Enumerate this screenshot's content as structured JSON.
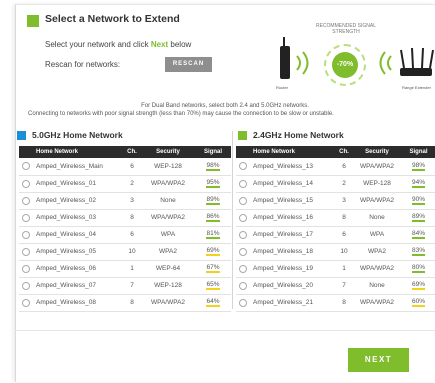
{
  "header": {
    "title": "Select a Network to Extend",
    "select_prefix": "Select your network and click ",
    "select_highlight": "Next",
    "select_suffix": " below",
    "rescan_prompt": "Rescan for networks:",
    "rescan_label": "RESCAN"
  },
  "diagram": {
    "recommended_label": "RECOMMENDED SIGNAL STRENGTH",
    "percent": "-70%",
    "router_label": "Router",
    "extender_label": "Range Extender"
  },
  "info": {
    "line1": "For Dual Band networks, select both 2.4 and 5.0GHz networks.",
    "line2": "Connecting to networks with poor signal strength (less than 70%) may cause the connection to be slow or unstable."
  },
  "colors": {
    "accent_green": "#7fbd2d",
    "five_ghz_blue": "#1a8fd6",
    "signal_green": "#7fbd2d",
    "signal_yellow": "#f2d21b"
  },
  "columns": {
    "network": "Home Network",
    "channel": "Ch.",
    "security": "Security",
    "signal": "Signal"
  },
  "band5": {
    "title": "5.0GHz Home Network",
    "rows": [
      {
        "name": "Amped_Wireless_Main",
        "ch": "6",
        "sec": "WEP-128",
        "sig": "98%",
        "level": "good"
      },
      {
        "name": "Amped_Wireless_01",
        "ch": "2",
        "sec": "WPA/WPA2",
        "sig": "95%",
        "level": "good"
      },
      {
        "name": "Amped_Wireless_02",
        "ch": "3",
        "sec": "None",
        "sig": "89%",
        "level": "good"
      },
      {
        "name": "Amped_Wireless_03",
        "ch": "8",
        "sec": "WPA/WPA2",
        "sig": "86%",
        "level": "good"
      },
      {
        "name": "Amped_Wireless_04",
        "ch": "6",
        "sec": "WPA",
        "sig": "81%",
        "level": "good"
      },
      {
        "name": "Amped_Wireless_05",
        "ch": "10",
        "sec": "WPA2",
        "sig": "69%",
        "level": "poor"
      },
      {
        "name": "Amped_Wireless_06",
        "ch": "1",
        "sec": "WEP-64",
        "sig": "67%",
        "level": "poor"
      },
      {
        "name": "Amped_Wireless_07",
        "ch": "7",
        "sec": "WEP-128",
        "sig": "65%",
        "level": "poor"
      },
      {
        "name": "Amped_Wireless_08",
        "ch": "8",
        "sec": "WPA/WPA2",
        "sig": "64%",
        "level": "poor"
      }
    ]
  },
  "band24": {
    "title": "2.4GHz Home Network",
    "rows": [
      {
        "name": "Amped_Wireless_13",
        "ch": "6",
        "sec": "WPA/WPA2",
        "sig": "98%",
        "level": "good"
      },
      {
        "name": "Amped_Wireless_14",
        "ch": "2",
        "sec": "WEP-128",
        "sig": "94%",
        "level": "good"
      },
      {
        "name": "Amped_Wireless_15",
        "ch": "3",
        "sec": "WPA/WPA2",
        "sig": "90%",
        "level": "good"
      },
      {
        "name": "Amped_Wireless_16",
        "ch": "8",
        "sec": "None",
        "sig": "89%",
        "level": "good"
      },
      {
        "name": "Amped_Wireless_17",
        "ch": "6",
        "sec": "WPA",
        "sig": "84%",
        "level": "good"
      },
      {
        "name": "Amped_Wireless_18",
        "ch": "10",
        "sec": "WPA2",
        "sig": "83%",
        "level": "good"
      },
      {
        "name": "Amped_Wireless_19",
        "ch": "1",
        "sec": "WPA/WPA2",
        "sig": "80%",
        "level": "good"
      },
      {
        "name": "Amped_Wireless_20",
        "ch": "7",
        "sec": "None",
        "sig": "69%",
        "level": "poor"
      },
      {
        "name": "Amped_Wireless_21",
        "ch": "8",
        "sec": "WPA/WPA2",
        "sig": "60%",
        "level": "poor"
      }
    ]
  },
  "footer": {
    "next_label": "NEXT"
  }
}
